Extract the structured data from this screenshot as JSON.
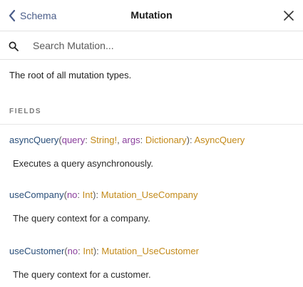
{
  "header": {
    "back_label": "Schema",
    "title": "Mutation"
  },
  "search": {
    "placeholder": "Search Mutation..."
  },
  "description": "The root of all mutation types.",
  "fields_heading": "FIELDS",
  "fields": [
    {
      "name": "asyncQuery",
      "args": [
        {
          "name": "query",
          "type": "String!"
        },
        {
          "name": "args",
          "type": "Dictionary"
        }
      ],
      "return_type": "AsyncQuery",
      "description": "Executes a query asynchronously."
    },
    {
      "name": "useCompany",
      "args": [
        {
          "name": "no",
          "type": "Int"
        }
      ],
      "return_type": "Mutation_UseCompany",
      "description": "The query context for a company."
    },
    {
      "name": "useCustomer",
      "args": [
        {
          "name": "no",
          "type": "Int"
        }
      ],
      "return_type": "Mutation_UseCustomer",
      "description": "The query context for a customer."
    }
  ],
  "colors": {
    "field_name": "#2a4f7a",
    "arg_name": "#8a3f9c",
    "type": "#c38a1a",
    "back_link": "#4b5e8a"
  },
  "icons": {
    "back": "chevron-left-icon",
    "close": "close-icon",
    "search": "search-icon"
  }
}
